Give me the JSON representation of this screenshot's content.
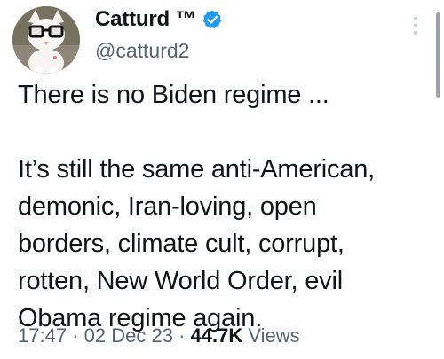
{
  "author": {
    "display_name": "Catturd ™",
    "handle": "@catturd2",
    "verified": true,
    "verified_color": "#1d9bf0"
  },
  "avatar": {
    "description_icon": "cat-with-glasses-avatar"
  },
  "tweet": {
    "lines": [
      "There is no Biden regime ...",
      "",
      "It’s still the same anti-American,",
      "demonic, Iran-loving, open",
      "borders, climate cult, corrupt,",
      "rotten, New World Order, evil",
      "Obama regime again."
    ]
  },
  "meta": {
    "time": "17:47",
    "separator": "·",
    "date": "02 Dec 23",
    "views_count": "44.7K",
    "views_label": "Views"
  },
  "icons": {
    "more": "more-vertical-icon",
    "verified": "verified-badge-icon"
  }
}
